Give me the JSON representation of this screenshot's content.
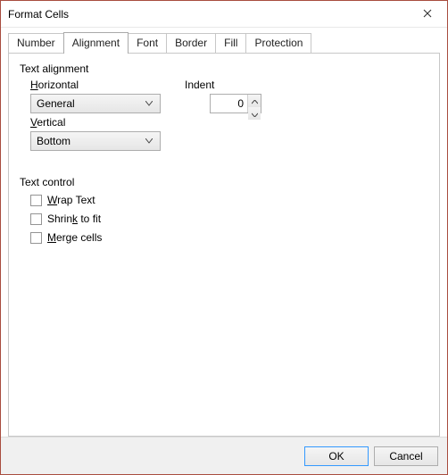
{
  "window": {
    "title": "Format Cells"
  },
  "tabs": {
    "number": "Number",
    "alignment": "Alignment",
    "font": "Font",
    "border": "Border",
    "fill": "Fill",
    "protection": "Protection",
    "active": "alignment"
  },
  "groups": {
    "text_alignment": "Text alignment",
    "text_control": "Text control"
  },
  "fields": {
    "horizontal_label": "Horizontal",
    "horizontal_value": "General",
    "vertical_label": "Vertical",
    "vertical_value": "Bottom",
    "indent_label": "Indent",
    "indent_value": "0"
  },
  "checks": {
    "wrap_text": "Wrap Text",
    "shrink_to_fit": "Shrink to fit",
    "merge_cells": "Merge cells"
  },
  "buttons": {
    "ok": "OK",
    "cancel": "Cancel"
  }
}
